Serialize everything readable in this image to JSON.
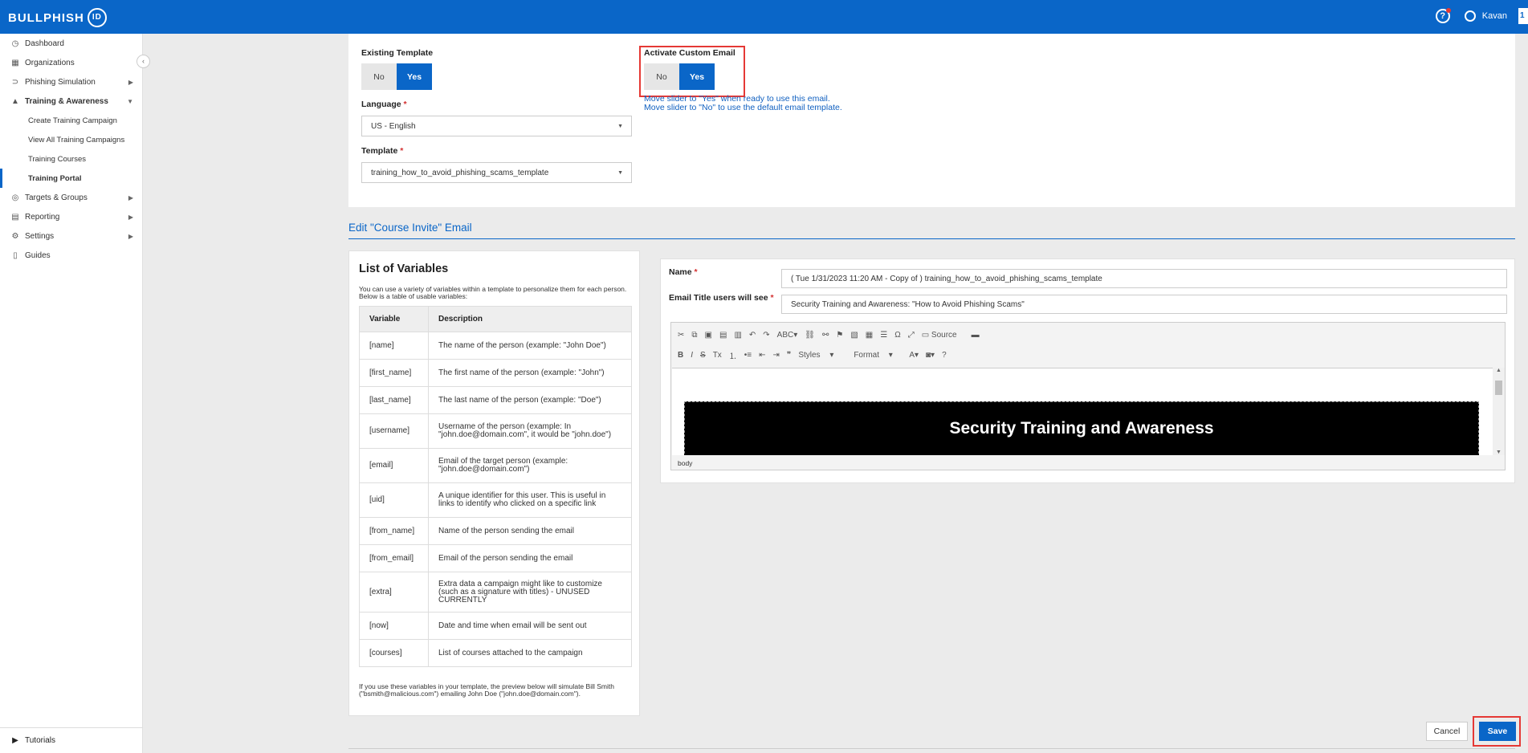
{
  "header": {
    "logo_text": "BULLPHISH",
    "logo_badge": "ID",
    "user_name": "Kavan",
    "help_icon": "question-circle-icon",
    "user_icon": "user-circle-icon",
    "edge_tab": "1"
  },
  "sidebar": {
    "items": [
      {
        "label": "Dashboard",
        "icon": "dashboard-icon"
      },
      {
        "label": "Organizations",
        "icon": "building-icon"
      },
      {
        "label": "Phishing Simulation",
        "icon": "hook-icon"
      },
      {
        "label": "Training & Awareness",
        "icon": "graduation-cap-icon"
      },
      {
        "label": "Targets & Groups",
        "icon": "target-icon"
      },
      {
        "label": "Reporting",
        "icon": "report-icon"
      },
      {
        "label": "Settings",
        "icon": "gear-icon"
      },
      {
        "label": "Guides",
        "icon": "book-icon"
      }
    ],
    "subitems": [
      {
        "label": "Create Training Campaign"
      },
      {
        "label": "View All Training Campaigns"
      },
      {
        "label": "Training Courses"
      },
      {
        "label": "Training Portal"
      }
    ],
    "tutorials": "Tutorials"
  },
  "form": {
    "existing_template_label": "Existing Template",
    "activate_label": "Activate Custom Email",
    "no": "No",
    "yes": "Yes",
    "language_label": "Language",
    "language_value": "US - English",
    "template_label": "Template",
    "template_value": "training_how_to_avoid_phishing_scams_template",
    "hint_line1": "Move slider to \"Yes\" when ready to use this email.",
    "hint_line2": "Move slider to \"No\" to use the default email template.",
    "required_mark": "*"
  },
  "section": {
    "title": "Edit \"Course Invite\" Email"
  },
  "variables": {
    "title": "List of Variables",
    "intro": "You can use a variety of variables within a template to personalize them for each person. Below is a table of usable variables:",
    "col_variable": "Variable",
    "col_description": "Description",
    "rows": [
      {
        "variable": "[name]",
        "description": "The name of the person (example: \"John Doe\")"
      },
      {
        "variable": "[first_name]",
        "description": "The first name of the person (example: \"John\")"
      },
      {
        "variable": "[last_name]",
        "description": "The last name of the person (example: \"Doe\")"
      },
      {
        "variable": "[username]",
        "description": "Username of the person (example: In \"john.doe@domain.com\", it would be \"john.doe\")"
      },
      {
        "variable": "[email]",
        "description": "Email of the target person (example: \"john.doe@domain.com\")"
      },
      {
        "variable": "[uid]",
        "description": "A unique identifier for this user. This is useful in links to identify who clicked on a specific link"
      },
      {
        "variable": "[from_name]",
        "description": "Name of the person sending the email"
      },
      {
        "variable": "[from_email]",
        "description": "Email of the person sending the email"
      },
      {
        "variable": "[extra]",
        "description": "Extra data a campaign might like to customize (such as a signature with titles) - UNUSED CURRENTLY"
      },
      {
        "variable": "[now]",
        "description": "Date and time when email will be sent out"
      },
      {
        "variable": "[courses]",
        "description": "List of courses attached to the campaign"
      }
    ],
    "footer": "If you use these variables in your template, the preview below will simulate Bill Smith (\"bsmith@malicious.com\") emailing John Doe (\"john.doe@domain.com\")."
  },
  "email": {
    "name_label": "Name",
    "name_value": "( Tue 1/31/2023 11:20 AM - Copy of ) training_how_to_avoid_phishing_scams_template",
    "title_label": "Email Title users will see",
    "title_value": "Security Training and Awareness: \"How to Avoid Phishing Scams\"",
    "editor_source": "Source",
    "editor_styles": "Styles",
    "editor_format": "Format",
    "editor_banner": "Security Training and Awareness",
    "editor_status": "body"
  },
  "actions": {
    "cancel": "Cancel",
    "save": "Save"
  },
  "colors": {
    "primary": "#0a66c8",
    "highlight": "#e53935"
  }
}
